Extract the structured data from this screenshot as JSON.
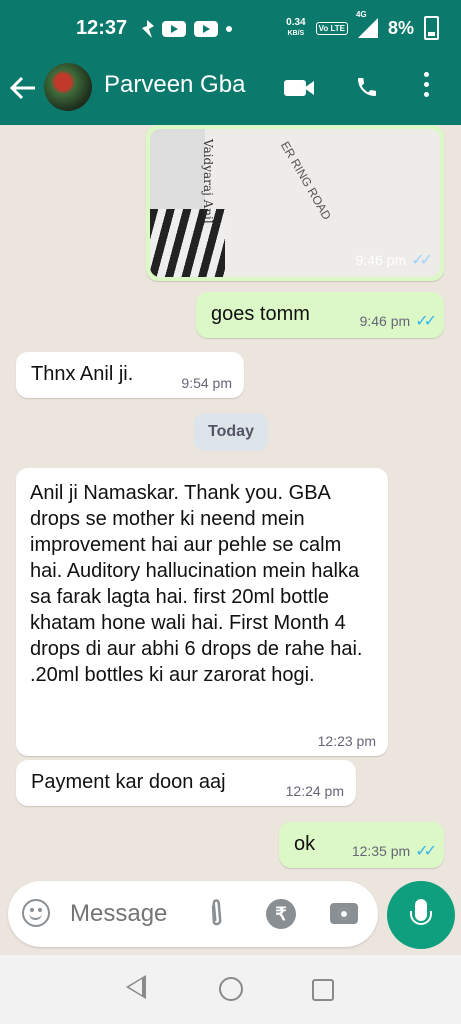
{
  "status_bar": {
    "time": "12:37",
    "net_speed": "0.34",
    "net_unit": "KB/S",
    "volte": "Vo LTE",
    "network": "4G",
    "battery": "8%"
  },
  "header": {
    "contact_name": "Parveen Gba",
    "icons": [
      "back-arrow-icon",
      "video-call-icon",
      "phone-call-icon",
      "more-menu-icon"
    ],
    "accent_color": "#0b7a6c"
  },
  "messages": [
    {
      "type": "image",
      "direction": "out",
      "time": "9:46 pm",
      "status": "read",
      "image_text": [
        "Vaidyaraj Anil",
        "ER RING ROAD"
      ]
    },
    {
      "type": "text",
      "direction": "out",
      "text": "goes tomm",
      "time": "9:46 pm",
      "status": "read"
    },
    {
      "type": "text",
      "direction": "in",
      "text": "Thnx Anil ji.",
      "time": "9:54 pm"
    },
    {
      "type": "divider",
      "text": "Today"
    },
    {
      "type": "text",
      "direction": "in",
      "text": "Anil ji Namaskar.  Thank you. GBA drops se mother ki neend mein improvement hai aur pehle se calm hai.  Auditory hallucination mein halka sa farak lagta hai.   first 20ml bottle khatam hone wali hai. First Month 4 drops di aur abhi  6 drops de rahe hai.  .20ml bottles ki aur zarorat hogi.",
      "time": "12:23 pm"
    },
    {
      "type": "text",
      "direction": "in",
      "text": "Payment kar doon aaj",
      "time": "12:24 pm"
    },
    {
      "type": "text",
      "direction": "out",
      "text": "ok",
      "time": "12:35 pm",
      "status": "read"
    }
  ],
  "composer": {
    "placeholder": "Message",
    "icons": [
      "emoji-icon",
      "attach-icon",
      "rupee-icon",
      "camera-icon",
      "mic-icon"
    ],
    "rupee_symbol": "₹"
  },
  "colors": {
    "outgoing_bubble": "#dcf8c6",
    "incoming_bubble": "#ffffff",
    "read_ticks": "#34b7f1",
    "mic_button": "#0f9e7e"
  }
}
